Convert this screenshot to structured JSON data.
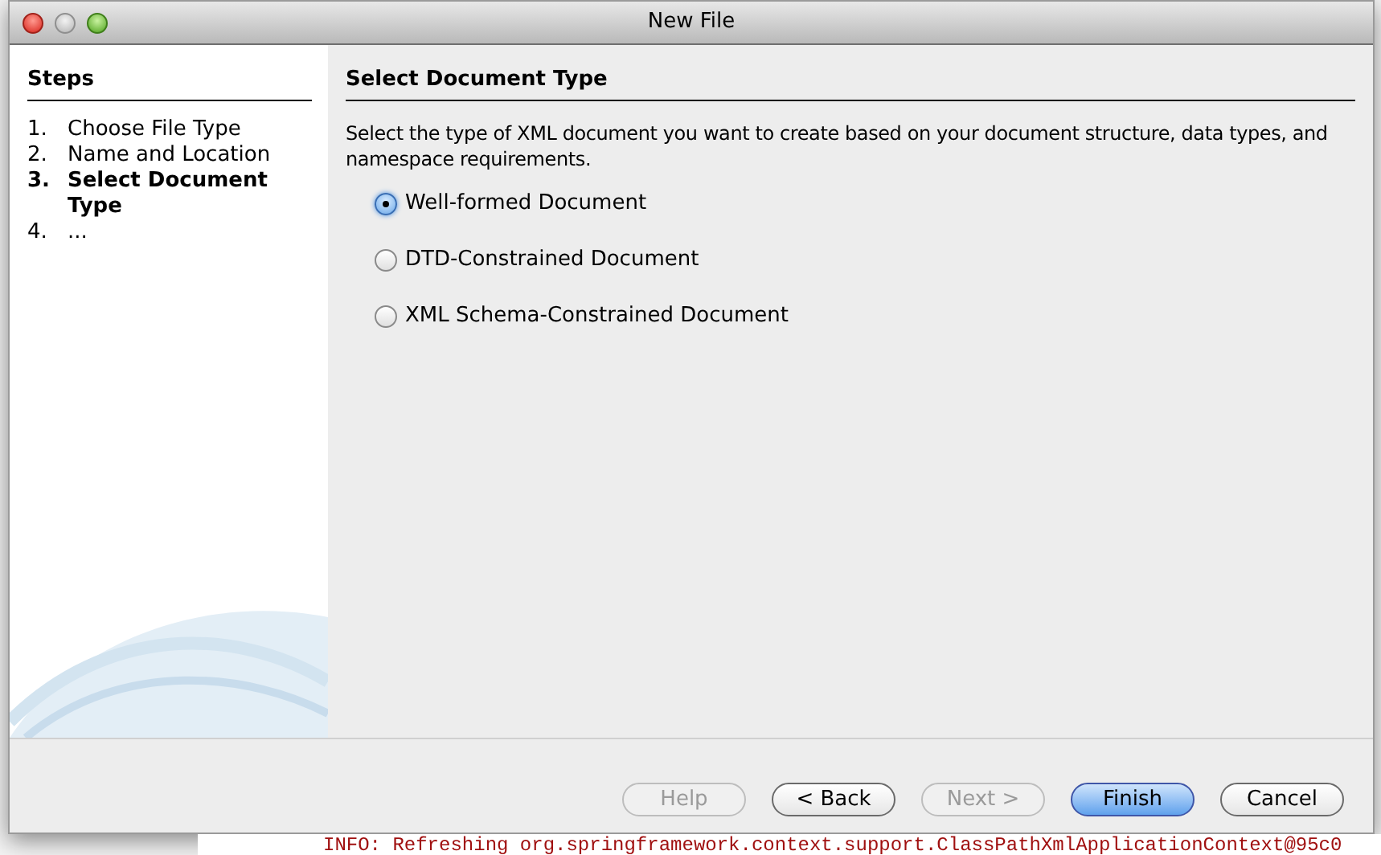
{
  "window": {
    "title": "New File"
  },
  "steps": {
    "title": "Steps",
    "items": [
      {
        "number": "1.",
        "label": "Choose File Type",
        "current": false
      },
      {
        "number": "2.",
        "label": "Name and Location",
        "current": false
      },
      {
        "number": "3.",
        "label": "Select Document Type",
        "current": true
      },
      {
        "number": "4.",
        "label": "...",
        "current": false
      }
    ]
  },
  "content": {
    "title": "Select Document Type",
    "description": "Select the type of XML document you want to create based on your document structure, data types, and namespace requirements.",
    "options": [
      {
        "label": "Well-formed Document",
        "selected": true
      },
      {
        "label": "DTD-Constrained Document",
        "selected": false
      },
      {
        "label": "XML Schema-Constrained Document",
        "selected": false
      }
    ]
  },
  "buttons": [
    {
      "label": "Help",
      "disabled": true,
      "default": false
    },
    {
      "label": "< Back",
      "disabled": false,
      "default": false
    },
    {
      "label": "Next >",
      "disabled": true,
      "default": false
    },
    {
      "label": "Finish",
      "disabled": false,
      "default": true
    },
    {
      "label": "Cancel",
      "disabled": false,
      "default": false
    }
  ],
  "console_line": "INFO: Refreshing org.springframework.context.support.ClassPathXmlApplicationContext@95c0"
}
